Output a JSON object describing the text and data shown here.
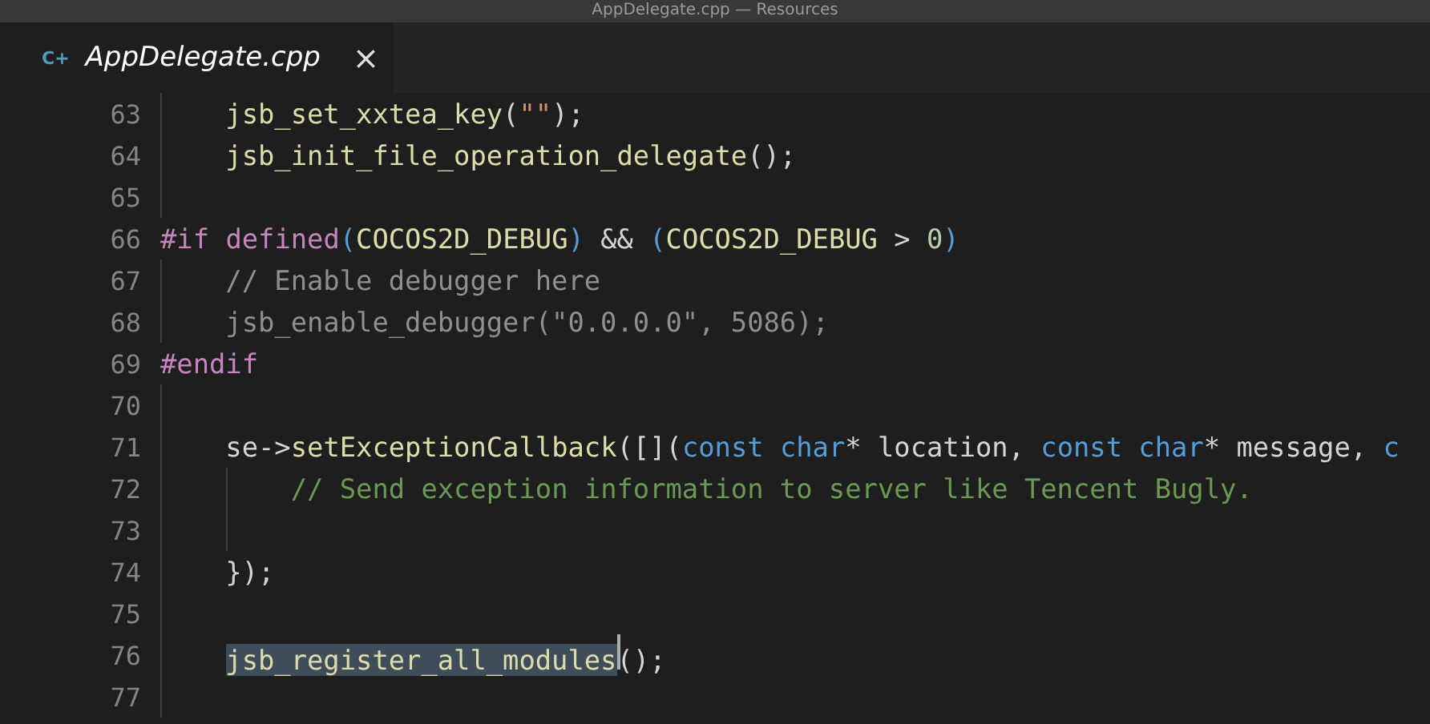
{
  "window": {
    "title": "AppDelegate.cpp — Resources"
  },
  "tabs": [
    {
      "icon": "C+",
      "label": "AppDelegate.cpp",
      "close": "×",
      "selected": true,
      "preview": true
    }
  ],
  "editor": {
    "lines": [
      {
        "number": "63",
        "kind": "body",
        "tokens": [
          {
            "kind": "fn",
            "text": "jsb_set_xxtea_key"
          },
          {
            "kind": "punct",
            "text": "("
          },
          {
            "kind": "str",
            "text": "\"\""
          },
          {
            "kind": "punct",
            "text": ");"
          }
        ]
      },
      {
        "number": "64",
        "kind": "body",
        "tokens": [
          {
            "kind": "fn",
            "text": "jsb_init_file_operation_delegate"
          },
          {
            "kind": "punct",
            "text": "();"
          }
        ]
      },
      {
        "number": "65",
        "kind": "body"
      },
      {
        "number": "66",
        "kind": "flush",
        "tokens": [
          {
            "kind": "pp",
            "text": "#if "
          },
          {
            "kind": "pp",
            "text": "defined"
          },
          {
            "kind": "paren",
            "text": "("
          },
          {
            "kind": "macro",
            "text": "COCOS2D_DEBUG"
          },
          {
            "kind": "paren",
            "text": ")"
          },
          {
            "kind": "punct",
            "text": " && "
          },
          {
            "kind": "paren",
            "text": "("
          },
          {
            "kind": "macro",
            "text": "COCOS2D_DEBUG"
          },
          {
            "kind": "punct",
            "text": " > "
          },
          {
            "kind": "num",
            "text": "0"
          },
          {
            "kind": "paren",
            "text": ")"
          }
        ]
      },
      {
        "number": "67",
        "kind": "body",
        "tokens": [
          {
            "kind": "inactive",
            "text": "// Enable debugger here"
          }
        ]
      },
      {
        "number": "68",
        "kind": "body",
        "tokens": [
          {
            "kind": "inactive",
            "text": "jsb_enable_debugger(\"0.0.0.0\", 5086);"
          }
        ]
      },
      {
        "number": "69",
        "kind": "flush",
        "tokens": [
          {
            "kind": "pp",
            "text": "#endif"
          }
        ]
      },
      {
        "number": "70",
        "kind": "body"
      },
      {
        "number": "71",
        "kind": "body",
        "tokens": [
          {
            "kind": "ident",
            "text": "se->"
          },
          {
            "kind": "fn",
            "text": "setExceptionCallback"
          },
          {
            "kind": "punct",
            "text": "([]("
          },
          {
            "kind": "kw",
            "text": "const char"
          },
          {
            "kind": "ident",
            "text": "* location, "
          },
          {
            "kind": "kw",
            "text": "const char"
          },
          {
            "kind": "ident",
            "text": "* message, "
          },
          {
            "kind": "kw",
            "text": "c"
          }
        ]
      },
      {
        "number": "72",
        "kind": "nested",
        "tokens": [
          {
            "kind": "comment",
            "text": "// Send exception information to server like Tencent Bugly."
          }
        ]
      },
      {
        "number": "73",
        "kind": "nested"
      },
      {
        "number": "74",
        "kind": "body",
        "tokens": [
          {
            "kind": "punct",
            "text": "});"
          }
        ]
      },
      {
        "number": "75",
        "kind": "body"
      },
      {
        "number": "76",
        "kind": "body",
        "tokens": [
          {
            "kind": "fn-selected",
            "text": "jsb_register_all_modules"
          },
          {
            "kind": "punct",
            "text": "();"
          }
        ]
      },
      {
        "number": "77",
        "kind": "body"
      }
    ]
  }
}
